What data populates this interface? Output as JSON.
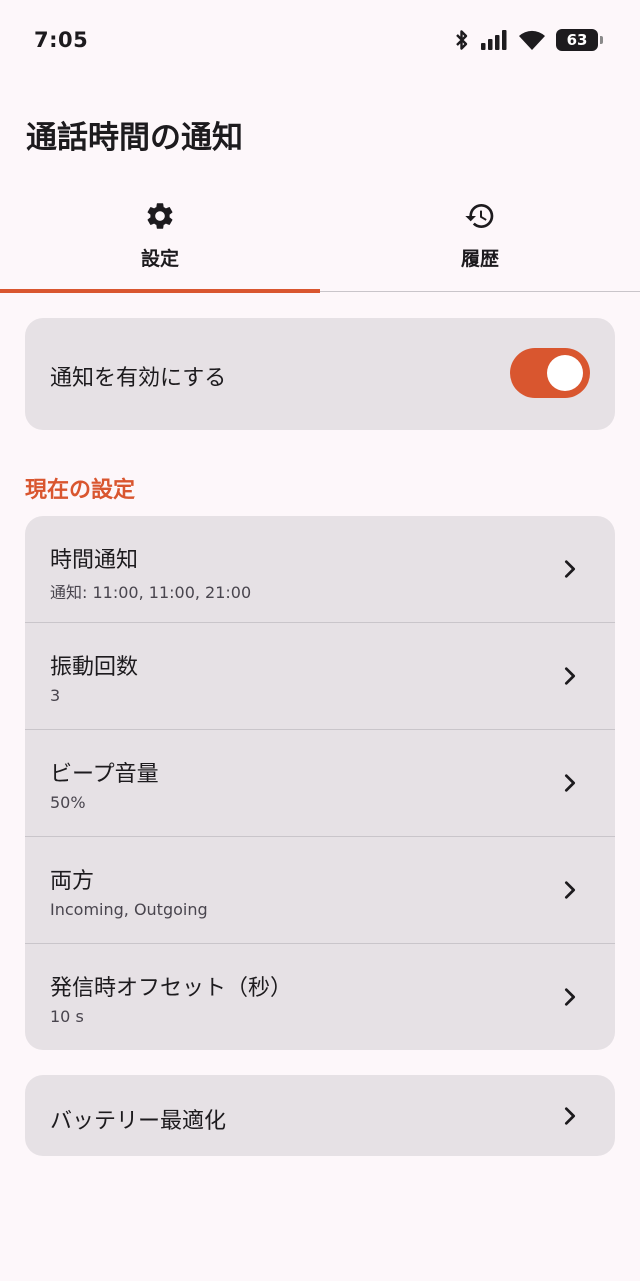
{
  "status": {
    "time": "7:05",
    "battery_level": "63"
  },
  "app": {
    "title": "通話時間の通知"
  },
  "tabs": [
    {
      "label": "設定",
      "icon": "gear-icon",
      "active": true
    },
    {
      "label": "履歴",
      "icon": "history-icon",
      "active": false
    }
  ],
  "enable": {
    "label": "通知を有効にする",
    "on": true
  },
  "section": {
    "header": "現在の設定"
  },
  "settings": [
    {
      "title": "時間通知",
      "subtitle": "通知: 11:00, 11:00, 21:00"
    },
    {
      "title": "振動回数",
      "subtitle": "3"
    },
    {
      "title": "ビープ音量",
      "subtitle": "50%"
    },
    {
      "title": "両方",
      "subtitle": "Incoming, Outgoing"
    },
    {
      "title": "発信時オフセット（秒）",
      "subtitle": "10 s"
    }
  ],
  "battery_optimization": {
    "label": "バッテリー最適化"
  },
  "colors": {
    "accent": "#d9562f",
    "background": "#fdf7fa",
    "card": "#e6e1e5"
  }
}
